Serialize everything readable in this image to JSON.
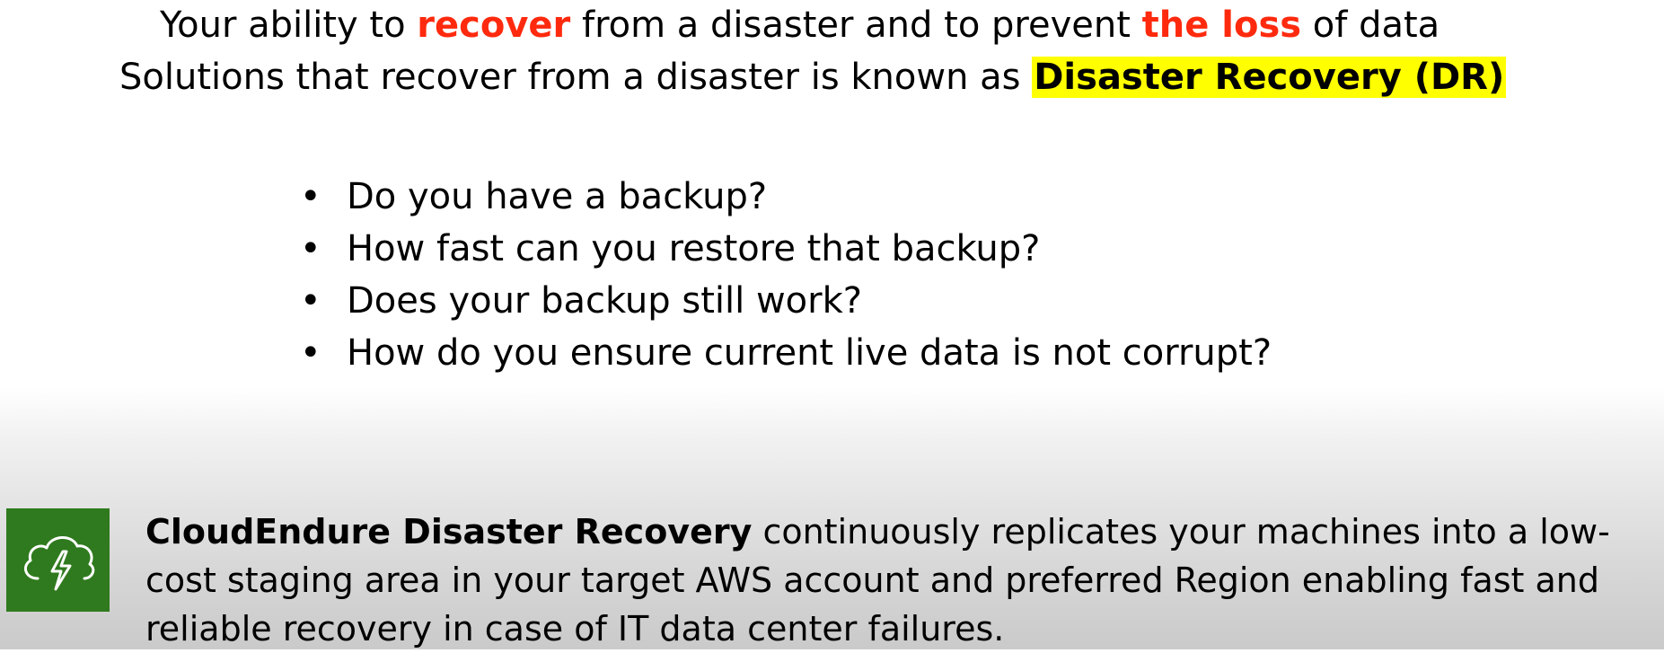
{
  "headline": {
    "line1": {
      "prefix": "Your ability to ",
      "emphasis1": "recover",
      "middle": " from a disaster and to prevent ",
      "emphasis2": "the loss",
      "suffix": " of data"
    },
    "line2": {
      "prefix": "Solutions that recover from a disaster is known as ",
      "highlight": "Disaster Recovery (DR)"
    }
  },
  "questions": [
    "Do you have a backup?",
    "How fast can you restore that backup?",
    "Does your backup still work?",
    "How do you ensure current live data is not corrupt?"
  ],
  "service": {
    "icon": "cloud-lightning-icon",
    "name": "CloudEndure Disaster Recovery",
    "description": " continuously replicates your machines into a low-cost staging area in your target AWS account and preferred Region enabling fast and reliable recovery in case of IT data center failures."
  },
  "colors": {
    "emphasis_red": "#ff2a0e",
    "highlight_yellow": "#ffff00",
    "icon_green": "#2f7a1e"
  }
}
